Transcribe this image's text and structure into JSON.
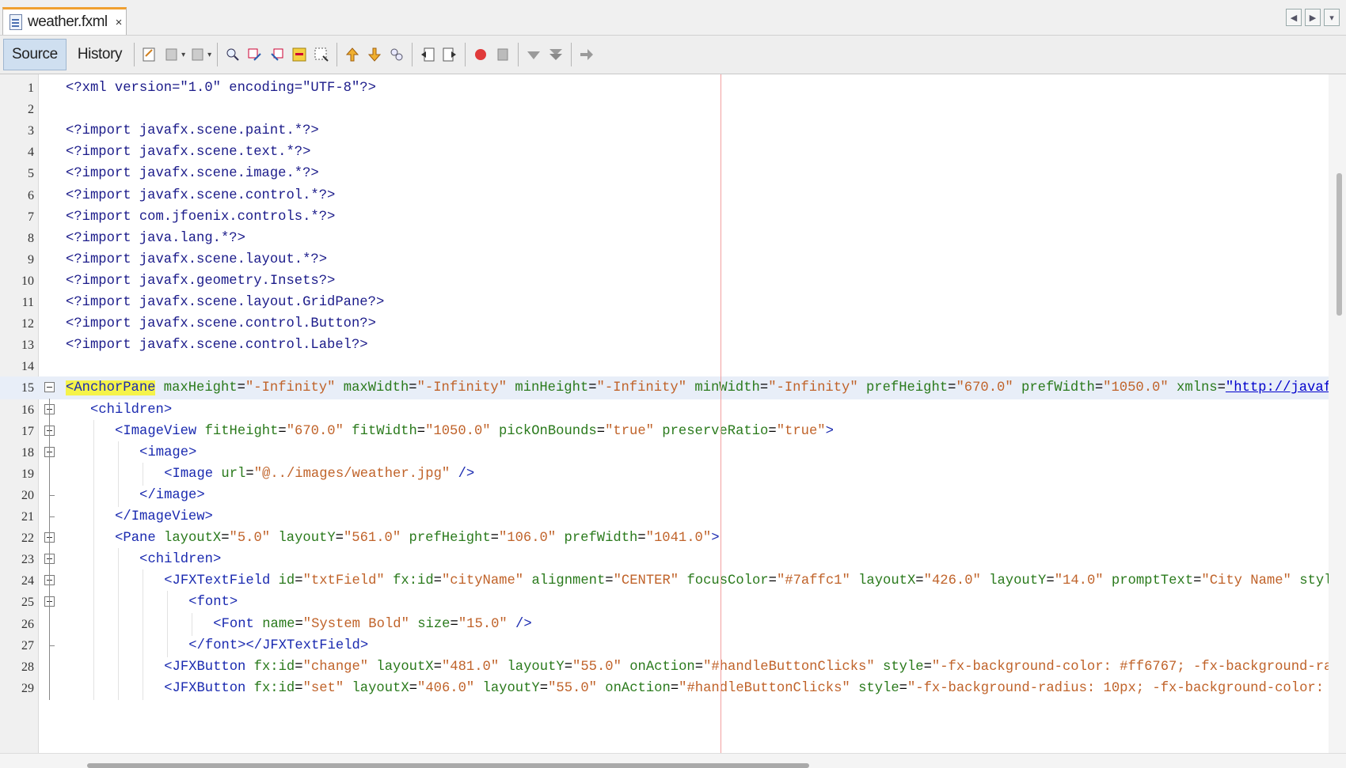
{
  "tab": {
    "title": "weather.fxml",
    "close": "×"
  },
  "toolbar": {
    "source_label": "Source",
    "history_label": "History"
  },
  "lines": [
    {
      "n": "1",
      "parts": [
        [
          "pi",
          "<?xml version=\"1.0\" encoding=\"UTF-8\"?>"
        ]
      ]
    },
    {
      "n": "2",
      "parts": []
    },
    {
      "n": "3",
      "parts": [
        [
          "pi",
          "<?import javafx.scene.paint.*?>"
        ]
      ]
    },
    {
      "n": "4",
      "parts": [
        [
          "pi",
          "<?import javafx.scene.text.*?>"
        ]
      ]
    },
    {
      "n": "5",
      "parts": [
        [
          "pi",
          "<?import javafx.scene.image.*?>"
        ]
      ]
    },
    {
      "n": "6",
      "parts": [
        [
          "pi",
          "<?import javafx.scene.control.*?>"
        ]
      ]
    },
    {
      "n": "7",
      "parts": [
        [
          "pi",
          "<?import com.jfoenix.controls.*?>"
        ]
      ]
    },
    {
      "n": "8",
      "parts": [
        [
          "pi",
          "<?import java.lang.*?>"
        ]
      ]
    },
    {
      "n": "9",
      "parts": [
        [
          "pi",
          "<?import javafx.scene.layout.*?>"
        ]
      ]
    },
    {
      "n": "10",
      "parts": [
        [
          "pi",
          "<?import javafx.geometry.Insets?>"
        ]
      ]
    },
    {
      "n": "11",
      "parts": [
        [
          "pi",
          "<?import javafx.scene.layout.GridPane?>"
        ]
      ]
    },
    {
      "n": "12",
      "parts": [
        [
          "pi",
          "<?import javafx.scene.control.Button?>"
        ]
      ]
    },
    {
      "n": "13",
      "parts": [
        [
          "pi",
          "<?import javafx.scene.control.Label?>"
        ]
      ]
    },
    {
      "n": "14",
      "parts": []
    },
    {
      "n": "15",
      "parts": [
        [
          "hl",
          "<AnchorPane"
        ],
        [
          "plain",
          " "
        ],
        [
          "attr",
          "maxHeight"
        ],
        [
          "plain",
          "="
        ],
        [
          "val",
          "\"-Infinity\""
        ],
        [
          "plain",
          " "
        ],
        [
          "attr",
          "maxWidth"
        ],
        [
          "plain",
          "="
        ],
        [
          "val",
          "\"-Infinity\""
        ],
        [
          "plain",
          " "
        ],
        [
          "attr",
          "minHeight"
        ],
        [
          "plain",
          "="
        ],
        [
          "val",
          "\"-Infinity\""
        ],
        [
          "plain",
          " "
        ],
        [
          "attr",
          "minWidth"
        ],
        [
          "plain",
          "="
        ],
        [
          "val",
          "\"-Infinity\""
        ],
        [
          "plain",
          " "
        ],
        [
          "attr",
          "prefHeight"
        ],
        [
          "plain",
          "="
        ],
        [
          "val",
          "\"670.0\""
        ],
        [
          "plain",
          " "
        ],
        [
          "attr",
          "prefWidth"
        ],
        [
          "plain",
          "="
        ],
        [
          "val",
          "\"1050.0\""
        ],
        [
          "plain",
          " "
        ],
        [
          "attr",
          "xmlns"
        ],
        [
          "plain",
          "="
        ],
        [
          "link",
          "\"http://javaf"
        ]
      ]
    },
    {
      "n": "16",
      "parts": [
        [
          "tag",
          "<children>"
        ]
      ]
    },
    {
      "n": "17",
      "parts": [
        [
          "tag",
          "<ImageView"
        ],
        [
          "plain",
          " "
        ],
        [
          "attr",
          "fitHeight"
        ],
        [
          "plain",
          "="
        ],
        [
          "val",
          "\"670.0\""
        ],
        [
          "plain",
          " "
        ],
        [
          "attr",
          "fitWidth"
        ],
        [
          "plain",
          "="
        ],
        [
          "val",
          "\"1050.0\""
        ],
        [
          "plain",
          " "
        ],
        [
          "attr",
          "pickOnBounds"
        ],
        [
          "plain",
          "="
        ],
        [
          "val",
          "\"true\""
        ],
        [
          "plain",
          " "
        ],
        [
          "attr",
          "preserveRatio"
        ],
        [
          "plain",
          "="
        ],
        [
          "val",
          "\"true\""
        ],
        [
          "tag",
          ">"
        ]
      ]
    },
    {
      "n": "18",
      "parts": [
        [
          "tag",
          "<image>"
        ]
      ]
    },
    {
      "n": "19",
      "parts": [
        [
          "tag",
          "<Image"
        ],
        [
          "plain",
          " "
        ],
        [
          "attr",
          "url"
        ],
        [
          "plain",
          "="
        ],
        [
          "val",
          "\"@../images/weather.jpg\""
        ],
        [
          "plain",
          " "
        ],
        [
          "tag",
          "/>"
        ]
      ]
    },
    {
      "n": "20",
      "parts": [
        [
          "tag",
          "</image>"
        ]
      ]
    },
    {
      "n": "21",
      "parts": [
        [
          "tag",
          "</ImageView>"
        ]
      ]
    },
    {
      "n": "22",
      "parts": [
        [
          "tag",
          "<Pane"
        ],
        [
          "plain",
          " "
        ],
        [
          "attr",
          "layoutX"
        ],
        [
          "plain",
          "="
        ],
        [
          "val",
          "\"5.0\""
        ],
        [
          "plain",
          " "
        ],
        [
          "attr",
          "layoutY"
        ],
        [
          "plain",
          "="
        ],
        [
          "val",
          "\"561.0\""
        ],
        [
          "plain",
          " "
        ],
        [
          "attr",
          "prefHeight"
        ],
        [
          "plain",
          "="
        ],
        [
          "val",
          "\"106.0\""
        ],
        [
          "plain",
          " "
        ],
        [
          "attr",
          "prefWidth"
        ],
        [
          "plain",
          "="
        ],
        [
          "val",
          "\"1041.0\""
        ],
        [
          "tag",
          ">"
        ]
      ]
    },
    {
      "n": "23",
      "parts": [
        [
          "tag",
          "<children>"
        ]
      ]
    },
    {
      "n": "24",
      "parts": [
        [
          "tag",
          "<JFXTextField"
        ],
        [
          "plain",
          " "
        ],
        [
          "attr",
          "id"
        ],
        [
          "plain",
          "="
        ],
        [
          "val",
          "\"txtField\""
        ],
        [
          "plain",
          " "
        ],
        [
          "attr",
          "fx:id"
        ],
        [
          "plain",
          "="
        ],
        [
          "val",
          "\"cityName\""
        ],
        [
          "plain",
          " "
        ],
        [
          "attr",
          "alignment"
        ],
        [
          "plain",
          "="
        ],
        [
          "val",
          "\"CENTER\""
        ],
        [
          "plain",
          " "
        ],
        [
          "attr",
          "focusColor"
        ],
        [
          "plain",
          "="
        ],
        [
          "val",
          "\"#7affc1\""
        ],
        [
          "plain",
          " "
        ],
        [
          "attr",
          "layoutX"
        ],
        [
          "plain",
          "="
        ],
        [
          "val",
          "\"426.0\""
        ],
        [
          "plain",
          " "
        ],
        [
          "attr",
          "layoutY"
        ],
        [
          "plain",
          "="
        ],
        [
          "val",
          "\"14.0\""
        ],
        [
          "plain",
          " "
        ],
        [
          "attr",
          "promptText"
        ],
        [
          "plain",
          "="
        ],
        [
          "val",
          "\"City Name\""
        ],
        [
          "plain",
          " "
        ],
        [
          "attr",
          "styl"
        ]
      ]
    },
    {
      "n": "25",
      "parts": [
        [
          "tag",
          "<font>"
        ]
      ]
    },
    {
      "n": "26",
      "parts": [
        [
          "tag",
          "<Font"
        ],
        [
          "plain",
          " "
        ],
        [
          "attr",
          "name"
        ],
        [
          "plain",
          "="
        ],
        [
          "val",
          "\"System Bold\""
        ],
        [
          "plain",
          " "
        ],
        [
          "attr",
          "size"
        ],
        [
          "plain",
          "="
        ],
        [
          "val",
          "\"15.0\""
        ],
        [
          "plain",
          " "
        ],
        [
          "tag",
          "/>"
        ]
      ]
    },
    {
      "n": "27",
      "parts": [
        [
          "tag",
          "</font></JFXTextField>"
        ]
      ]
    },
    {
      "n": "28",
      "parts": [
        [
          "tag",
          "<JFXButton"
        ],
        [
          "plain",
          " "
        ],
        [
          "attr",
          "fx:id"
        ],
        [
          "plain",
          "="
        ],
        [
          "val",
          "\"change\""
        ],
        [
          "plain",
          " "
        ],
        [
          "attr",
          "layoutX"
        ],
        [
          "plain",
          "="
        ],
        [
          "val",
          "\"481.0\""
        ],
        [
          "plain",
          " "
        ],
        [
          "attr",
          "layoutY"
        ],
        [
          "plain",
          "="
        ],
        [
          "val",
          "\"55.0\""
        ],
        [
          "plain",
          " "
        ],
        [
          "attr",
          "onAction"
        ],
        [
          "plain",
          "="
        ],
        [
          "val",
          "\"#handleButtonClicks\""
        ],
        [
          "plain",
          " "
        ],
        [
          "attr",
          "style"
        ],
        [
          "plain",
          "="
        ],
        [
          "val",
          "\"-fx-background-color: #ff6767; -fx-background-ra"
        ]
      ]
    },
    {
      "n": "29",
      "parts": [
        [
          "tag",
          "<JFXButton"
        ],
        [
          "plain",
          " "
        ],
        [
          "attr",
          "fx:id"
        ],
        [
          "plain",
          "="
        ],
        [
          "val",
          "\"set\""
        ],
        [
          "plain",
          " "
        ],
        [
          "attr",
          "layoutX"
        ],
        [
          "plain",
          "="
        ],
        [
          "val",
          "\"406.0\""
        ],
        [
          "plain",
          " "
        ],
        [
          "attr",
          "layoutY"
        ],
        [
          "plain",
          "="
        ],
        [
          "val",
          "\"55.0\""
        ],
        [
          "plain",
          " "
        ],
        [
          "attr",
          "onAction"
        ],
        [
          "plain",
          "="
        ],
        [
          "val",
          "\"#handleButtonClicks\""
        ],
        [
          "plain",
          " "
        ],
        [
          "attr",
          "style"
        ],
        [
          "plain",
          "="
        ],
        [
          "val",
          "\"-fx-background-radius: 10px; -fx-background-color:"
        ]
      ]
    }
  ]
}
